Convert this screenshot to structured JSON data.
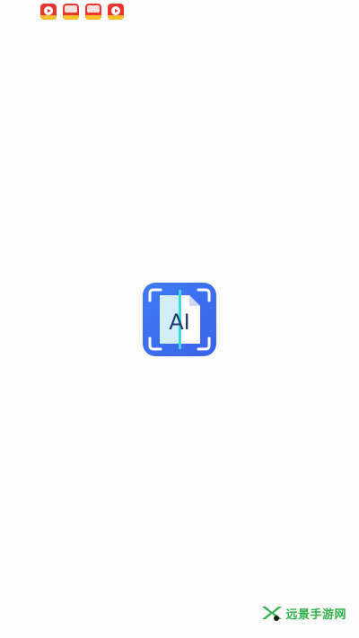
{
  "status_bar": {
    "icons": [
      {
        "name": "video-app-icon",
        "color": "#e8362f"
      },
      {
        "name": "news-app-icon",
        "color": "#e8362f"
      },
      {
        "name": "news-app-icon",
        "color": "#e8362f"
      },
      {
        "name": "video-app-icon",
        "color": "#e8362f"
      }
    ]
  },
  "splash": {
    "logo_text": "AI",
    "logo_colors": {
      "primary": "#3e7bf6",
      "page": "#d6f0ff",
      "scan_line": "#3fd9e6"
    }
  },
  "watermark": {
    "text": "远景手游网",
    "color": "#2fb34a"
  }
}
